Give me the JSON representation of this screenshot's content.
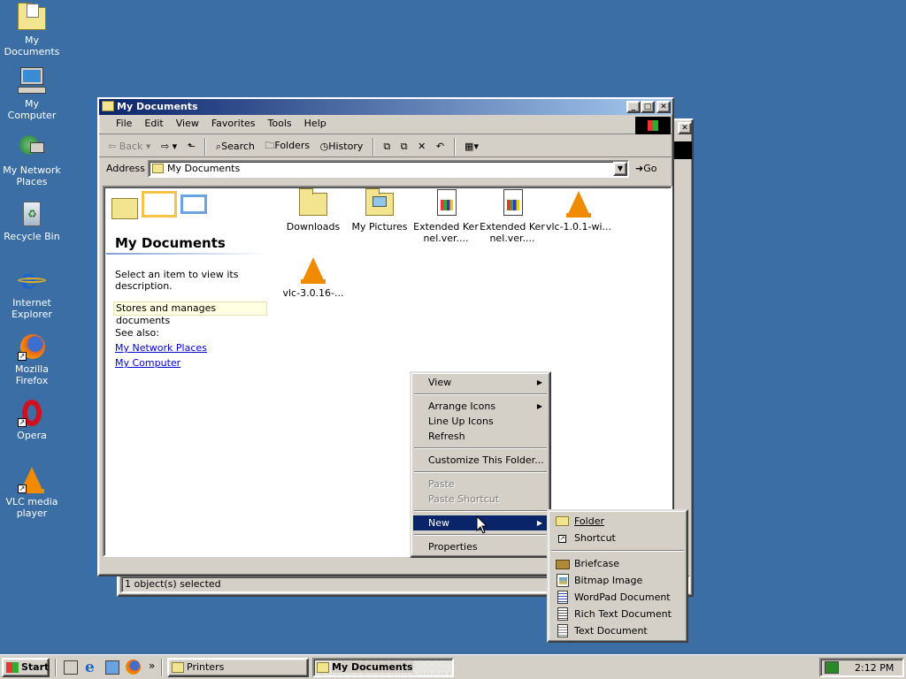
{
  "desktop": {
    "icons": [
      {
        "label": "My Documents",
        "icon": "my-documents-icon"
      },
      {
        "label": "My Computer",
        "icon": "my-computer-icon"
      },
      {
        "label": "My Network Places",
        "icon": "network-places-icon"
      },
      {
        "label": "Recycle Bin",
        "icon": "recycle-bin-icon"
      },
      {
        "label": "Internet Explorer",
        "icon": "internet-explorer-icon"
      },
      {
        "label": "Mozilla Firefox",
        "icon": "firefox-icon"
      },
      {
        "label": "Opera",
        "icon": "opera-icon"
      },
      {
        "label": "VLC media player",
        "icon": "vlc-icon"
      }
    ]
  },
  "window": {
    "title": "My Documents",
    "menu": [
      "File",
      "Edit",
      "View",
      "Favorites",
      "Tools",
      "Help"
    ],
    "toolbar": {
      "back": "Back",
      "search": "Search",
      "folders": "Folders",
      "history": "History"
    },
    "address": {
      "label": "Address",
      "value": "My Documents",
      "go": "Go"
    },
    "sidebar": {
      "title": "My Documents",
      "prompt": "Select an item to view its description.",
      "info": "Stores and manages documents",
      "see_also": "See also:",
      "links": [
        "My Network Places",
        "My Computer"
      ]
    },
    "files": [
      {
        "name": "Downloads",
        "type": "folder"
      },
      {
        "name": "My Pictures",
        "type": "folder"
      },
      {
        "name": "Extended Kernel.ver....",
        "type": "document"
      },
      {
        "name": "Extended Kernel.ver....",
        "type": "document"
      },
      {
        "name": "vlc-1.0.1-wi...",
        "type": "vlc"
      },
      {
        "name": "vlc-3.0.16-...",
        "type": "vlc"
      }
    ],
    "status": "1 object(s) selected"
  },
  "context_menu": {
    "items": [
      {
        "label": "View",
        "submenu": true
      },
      {
        "label": "Arrange Icons",
        "submenu": true
      },
      {
        "label": "Line Up Icons"
      },
      {
        "label": "Refresh"
      },
      {
        "label": "Customize This Folder..."
      },
      {
        "label": "Paste",
        "disabled": true
      },
      {
        "label": "Paste Shortcut",
        "disabled": true
      },
      {
        "label": "New",
        "submenu": true,
        "selected": true
      },
      {
        "label": "Properties"
      }
    ]
  },
  "new_submenu": {
    "items": [
      {
        "label": "Folder",
        "icon": "folder-icon"
      },
      {
        "label": "Shortcut",
        "icon": "shortcut-icon"
      },
      {
        "label": "Briefcase",
        "icon": "briefcase-icon"
      },
      {
        "label": "Bitmap Image",
        "icon": "bitmap-icon"
      },
      {
        "label": "WordPad Document",
        "icon": "wordpad-icon"
      },
      {
        "label": "Rich Text Document",
        "icon": "rtf-icon"
      },
      {
        "label": "Text Document",
        "icon": "text-doc-icon"
      }
    ]
  },
  "taskbar": {
    "start": "Start",
    "tasks": [
      "Printers",
      "My Documents"
    ],
    "clock": "2:12 PM"
  }
}
